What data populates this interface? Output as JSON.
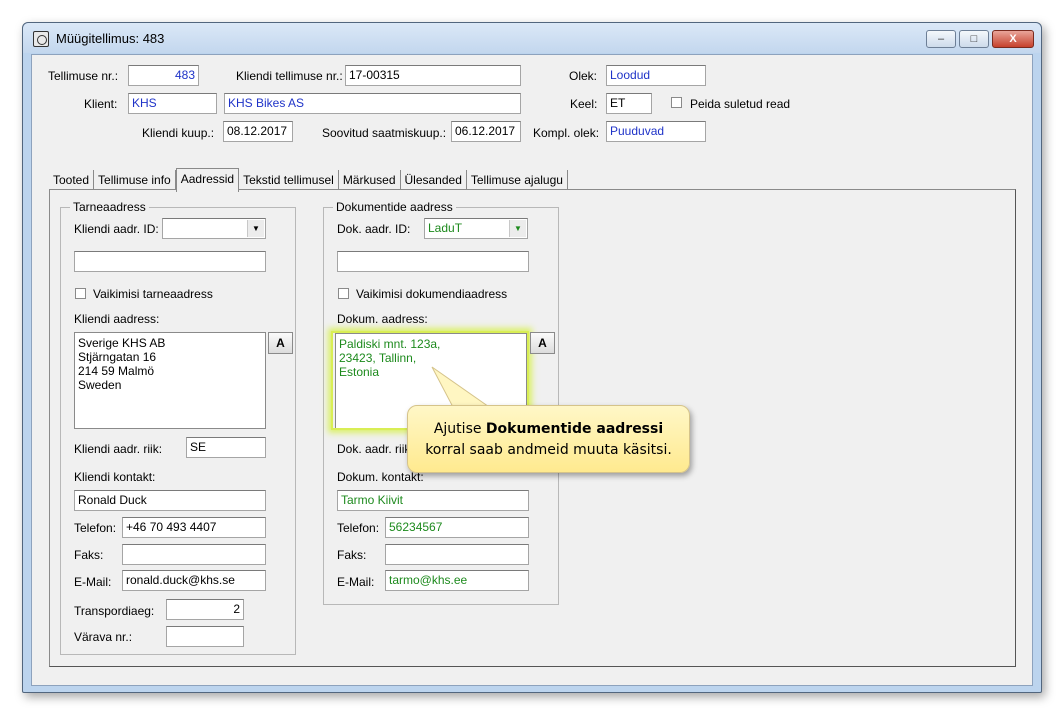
{
  "window": {
    "title": "Müügitellimus: 483",
    "minimize_label": "–",
    "maximize_label": "□",
    "close_label": "X"
  },
  "header": {
    "order_no_label": "Tellimuse nr.:",
    "order_no": "483",
    "client_order_no_label": "Kliendi tellimuse nr.:",
    "client_order_no": "17-00315",
    "status_label": "Olek:",
    "status": "Loodud",
    "client_label": "Klient:",
    "client_code": "KHS",
    "client_name": "KHS Bikes AS",
    "language_label": "Keel:",
    "language": "ET",
    "hide_closed_label": "Peida suletud read",
    "client_date_label": "Kliendi kuup.:",
    "client_date": "08.12.2017",
    "desired_delivery_label": "Soovitud saatmiskuup.:",
    "desired_delivery": "06.12.2017",
    "completion_status_label": "Kompl. olek:",
    "completion_status": "Puuduvad"
  },
  "tabs": [
    {
      "label": "Tooted"
    },
    {
      "label": "Tellimuse info"
    },
    {
      "label": "Aadressid"
    },
    {
      "label": "Tekstid tellimusel"
    },
    {
      "label": "Märkused"
    },
    {
      "label": "Ülesanded"
    },
    {
      "label": "Tellimuse ajalugu"
    }
  ],
  "delivery": {
    "group_title": "Tarneaadress",
    "addr_id_label": "Kliendi aadr. ID:",
    "addr_id_value": "",
    "extra_value": "",
    "default_label": "Vaikimisi tarneaadress",
    "address_label": "Kliendi aadress:",
    "address_lines": [
      "Sverige KHS AB",
      "Stjärngatan 16",
      "214 59 Malmö",
      "Sweden"
    ],
    "a_button": "A",
    "country_label": "Kliendi aadr. riik:",
    "country": "SE",
    "contact_label": "Kliendi kontakt:",
    "contact": "Ronald Duck",
    "phone_label": "Telefon:",
    "phone": "+46 70 493 4407",
    "fax_label": "Faks:",
    "fax": "",
    "email_label": "E-Mail:",
    "email": "ronald.duck@khs.se",
    "transit_label": "Transpordiaeg:",
    "transit": "2",
    "gate_label": "Värava nr.:",
    "gate": ""
  },
  "documents": {
    "group_title": "Dokumentide aadress",
    "addr_id_label": "Dok. aadr. ID:",
    "addr_id_value": "LaduT",
    "extra_value": "",
    "default_label": "Vaikimisi dokumendiaadress",
    "address_label": "Dokum. aadress:",
    "address_lines": [
      "Paldiski mnt. 123a,",
      "23423, Tallinn,",
      "Estonia"
    ],
    "a_button": "A",
    "country_label": "Dok. aadr. riik",
    "contact_label": "Dokum. kontakt:",
    "contact": "Tarmo Kiivit",
    "phone_label": "Telefon:",
    "phone": "56234567",
    "fax_label": "Faks:",
    "fax": "",
    "email_label": "E-Mail:",
    "email": "tarmo@khs.ee"
  },
  "callout": {
    "prefix": "Ajutise ",
    "bold": "Dokumentide aadressi",
    "line2": "korral saab andmeid muuta käsitsi."
  },
  "colors": {
    "value_blue": "#1f33c8",
    "value_green": "#1d8a1d",
    "callout_bg": "#ffea8f",
    "highlight": "#d9ee55"
  }
}
